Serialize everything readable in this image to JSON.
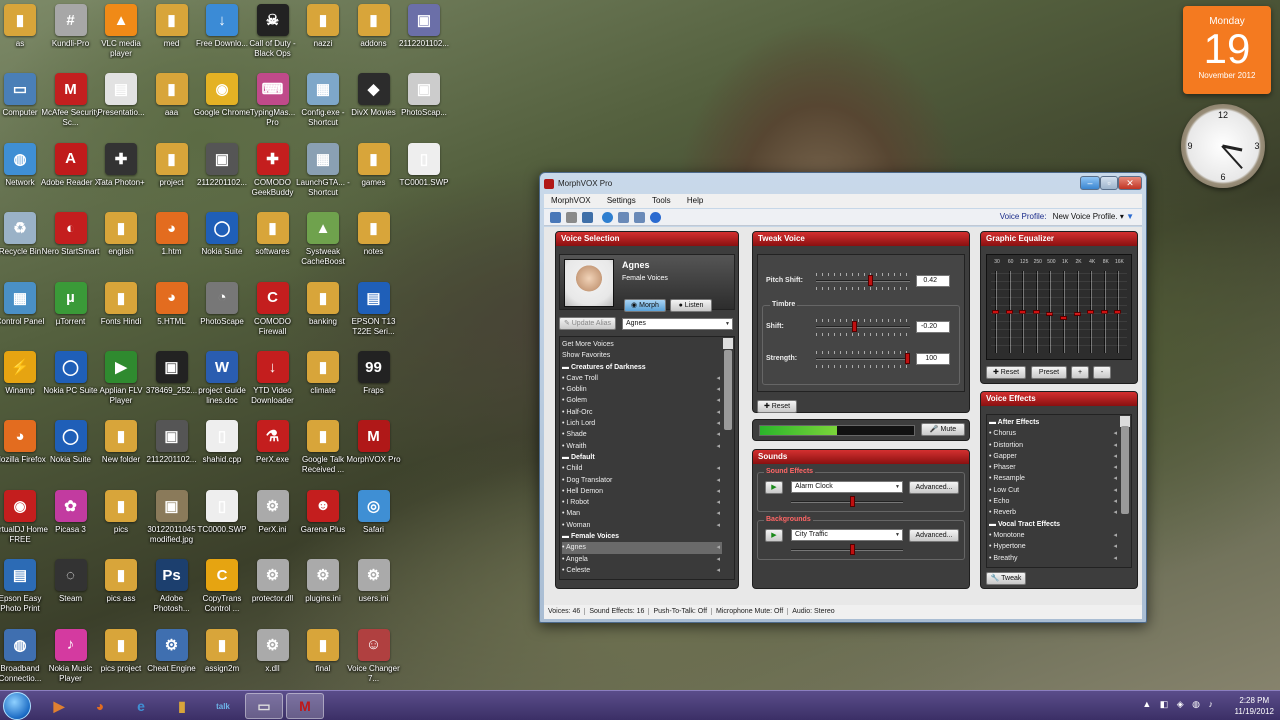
{
  "desktop_icons": [
    {
      "label": "as",
      "color": "#d8a53a",
      "glyph": "▮"
    },
    {
      "label": "Kundli-Pro",
      "color": "#a7a7a7",
      "glyph": "#"
    },
    {
      "label": "VLC media player",
      "color": "#f08a17",
      "glyph": "▲"
    },
    {
      "label": "med",
      "color": "#d8a53a",
      "glyph": "▮"
    },
    {
      "label": "Free Downlo...",
      "color": "#3b8bd6",
      "glyph": "↓"
    },
    {
      "label": "Call of Duty - Black Ops",
      "color": "#222",
      "glyph": "☠"
    },
    {
      "label": "nazzi",
      "color": "#d8a53a",
      "glyph": "▮"
    },
    {
      "label": "addons",
      "color": "#d8a53a",
      "glyph": "▮"
    },
    {
      "label": "2112201102...",
      "color": "#6b6fa8",
      "glyph": "▣"
    },
    {
      "label": "Computer",
      "color": "#4a7fb7",
      "glyph": "▭"
    },
    {
      "label": "McAfee Security Sc...",
      "color": "#c31f1f",
      "glyph": "M"
    },
    {
      "label": "Presentatio...",
      "color": "#e2e2e2",
      "glyph": "▤"
    },
    {
      "label": "aaa",
      "color": "#d8a53a",
      "glyph": "▮"
    },
    {
      "label": "Google Chrome",
      "color": "#e4b224",
      "glyph": "◉"
    },
    {
      "label": "TypingMas... Pro",
      "color": "#c04a8a",
      "glyph": "⌨"
    },
    {
      "label": "Config.exe - Shortcut",
      "color": "#7ea7c9",
      "glyph": "▦"
    },
    {
      "label": "DivX Movies",
      "color": "#2c2c2c",
      "glyph": "◆"
    },
    {
      "label": "PhotoScap...",
      "color": "#cccccc",
      "glyph": "▣"
    },
    {
      "label": "Network",
      "color": "#3f8fd4",
      "glyph": "◍"
    },
    {
      "label": "Adobe Reader X",
      "color": "#c01b1b",
      "glyph": "A"
    },
    {
      "label": "Tata Photon+",
      "color": "#333",
      "glyph": "✚"
    },
    {
      "label": "project",
      "color": "#d8a53a",
      "glyph": "▮"
    },
    {
      "label": "2112201102...",
      "color": "#555",
      "glyph": "▣"
    },
    {
      "label": "COMODO GeekBuddy",
      "color": "#c41e1e",
      "glyph": "✚"
    },
    {
      "label": "LaunchGTA... - Shortcut",
      "color": "#8aa0b3",
      "glyph": "▦"
    },
    {
      "label": "games",
      "color": "#d8a53a",
      "glyph": "▮"
    },
    {
      "label": "TC0001.SWP",
      "color": "#eeeeee",
      "glyph": "▯"
    },
    {
      "label": "Recycle Bin",
      "color": "#9ab2c7",
      "glyph": "♻"
    },
    {
      "label": "Nero StartSmart",
      "color": "#c41e1e",
      "glyph": "◐"
    },
    {
      "label": "english",
      "color": "#d8a53a",
      "glyph": "▮"
    },
    {
      "label": "1.htm",
      "color": "#e36c1f",
      "glyph": "◕"
    },
    {
      "label": "Nokia Suite",
      "color": "#1f5fb8",
      "glyph": "◯"
    },
    {
      "label": "softwares",
      "color": "#d8a53a",
      "glyph": "▮"
    },
    {
      "label": "Systweak CacheBoost",
      "color": "#6fa24d",
      "glyph": "▲"
    },
    {
      "label": "notes",
      "color": "#d8a53a",
      "glyph": "▮"
    },
    {
      "label": "Control Panel",
      "color": "#4a90c6",
      "glyph": "▦"
    },
    {
      "label": "µTorrent",
      "color": "#3a9a38",
      "glyph": "µ"
    },
    {
      "label": "Fonts Hindi",
      "color": "#d8a53a",
      "glyph": "▮"
    },
    {
      "label": "5.HTML",
      "color": "#e36c1f",
      "glyph": "◕"
    },
    {
      "label": "PhotoScape",
      "color": "#777",
      "glyph": "◔"
    },
    {
      "label": "COMODO Firewall",
      "color": "#c41e1e",
      "glyph": "C"
    },
    {
      "label": "banking",
      "color": "#d8a53a",
      "glyph": "▮"
    },
    {
      "label": "EPSON T13 T22E Seri...",
      "color": "#1f5fb8",
      "glyph": "▤"
    },
    {
      "label": "Winamp",
      "color": "#e6a411",
      "glyph": "⚡"
    },
    {
      "label": "Nokia PC Suite",
      "color": "#1f5fb8",
      "glyph": "◯"
    },
    {
      "label": "Applian FLV Player",
      "color": "#2f8a2f",
      "glyph": "▶"
    },
    {
      "label": "378469_252...",
      "color": "#222",
      "glyph": "▣"
    },
    {
      "label": "project Guide lines.doc",
      "color": "#2a5db0",
      "glyph": "W"
    },
    {
      "label": "YTD Video Downloader",
      "color": "#c41e1e",
      "glyph": "↓"
    },
    {
      "label": "climate",
      "color": "#d8a53a",
      "glyph": "▮"
    },
    {
      "label": "Fraps",
      "color": "#222",
      "glyph": "99"
    },
    {
      "label": "Mozilla Firefox",
      "color": "#e36c1f",
      "glyph": "◕"
    },
    {
      "label": "Nokia Suite",
      "color": "#1f5fb8",
      "glyph": "◯"
    },
    {
      "label": "New folder",
      "color": "#d8a53a",
      "glyph": "▮"
    },
    {
      "label": "2112201102...",
      "color": "#555",
      "glyph": "▣"
    },
    {
      "label": "shahid.cpp",
      "color": "#eeeeee",
      "glyph": "▯"
    },
    {
      "label": "PerX.exe",
      "color": "#c41e1e",
      "glyph": "⚗"
    },
    {
      "label": "Google Talk Received ...",
      "color": "#d8a53a",
      "glyph": "▮"
    },
    {
      "label": "MorphVOX Pro",
      "color": "#b01818",
      "glyph": "M"
    },
    {
      "label": "VirtualDJ Home FREE",
      "color": "#c41e1e",
      "glyph": "◉"
    },
    {
      "label": "Picasa 3",
      "color": "#c23ba0",
      "glyph": "✿"
    },
    {
      "label": "pics",
      "color": "#d8a53a",
      "glyph": "▮"
    },
    {
      "label": "30122011045 modified.jpg",
      "color": "#8a7a5a",
      "glyph": "▣"
    },
    {
      "label": "TC0000.SWP",
      "color": "#eeeeee",
      "glyph": "▯"
    },
    {
      "label": "PerX.ini",
      "color": "#aaaaaa",
      "glyph": "⚙"
    },
    {
      "label": "Garena Plus",
      "color": "#c41e1e",
      "glyph": "☻"
    },
    {
      "label": "Safari",
      "color": "#3f8fd4",
      "glyph": "◎"
    },
    {
      "label": "Epson Easy Photo Print",
      "color": "#2c6bb5",
      "glyph": "▤"
    },
    {
      "label": "Steam",
      "color": "#333",
      "glyph": "◌"
    },
    {
      "label": "pics ass",
      "color": "#d8a53a",
      "glyph": "▮"
    },
    {
      "label": "Adobe Photosh...",
      "color": "#1c3f6e",
      "glyph": "Ps"
    },
    {
      "label": "CopyTrans Control ...",
      "color": "#e6a411",
      "glyph": "C"
    },
    {
      "label": "protector.dll",
      "color": "#aaaaaa",
      "glyph": "⚙"
    },
    {
      "label": "plugins.ini",
      "color": "#aaaaaa",
      "glyph": "⚙"
    },
    {
      "label": "users.ini",
      "color": "#aaaaaa",
      "glyph": "⚙"
    },
    {
      "label": "Broadband Connectio...",
      "color": "#3f6fb0",
      "glyph": "◍"
    },
    {
      "label": "Nokia Music Player",
      "color": "#d43aa0",
      "glyph": "♪"
    },
    {
      "label": "pics project",
      "color": "#d8a53a",
      "glyph": "▮"
    },
    {
      "label": "Cheat Engine",
      "color": "#3f6fb0",
      "glyph": "⚙"
    },
    {
      "label": "assign2m",
      "color": "#d8a53a",
      "glyph": "▮"
    },
    {
      "label": "x.dll",
      "color": "#aaaaaa",
      "glyph": "⚙"
    },
    {
      "label": "final",
      "color": "#d8a53a",
      "glyph": "▮"
    },
    {
      "label": "Voice Changer 7...",
      "color": "#b04040",
      "glyph": "☺"
    }
  ],
  "calendar": {
    "weekday": "Monday",
    "day": "19",
    "month_year": "November 2012"
  },
  "clock": {
    "hour": 3,
    "minute": 23
  },
  "taskbar": {
    "time": "2:28 PM",
    "date": "11/19/2012",
    "pinned": [
      {
        "name": "start-button",
        "glyph": ""
      },
      {
        "name": "media-player",
        "glyph": "▶",
        "color": "#e08030"
      },
      {
        "name": "firefox",
        "glyph": "◕",
        "color": "#e36c1f"
      },
      {
        "name": "internet-explorer",
        "glyph": "e",
        "color": "#3f8fd4"
      },
      {
        "name": "explorer",
        "glyph": "▮",
        "color": "#d8a53a"
      },
      {
        "name": "google-talk",
        "glyph": "talk",
        "color": "#6db3e8"
      },
      {
        "name": "window-switcher",
        "glyph": "▭",
        "color": "#ddd"
      },
      {
        "name": "morphvox",
        "glyph": "M",
        "color": "#c01818"
      }
    ]
  },
  "app": {
    "title": "MorphVOX Pro",
    "menu": [
      "MorphVOX",
      "Settings",
      "Tools",
      "Help"
    ],
    "voice_profile_label": "Voice Profile:",
    "voice_profile_value": "New Voice Profile.",
    "voice_selection": {
      "header": "Voice Selection",
      "voice_name": "Agnes",
      "voice_category": "Female Voices",
      "morph_label": "Morph",
      "listen_label": "Listen",
      "update_alias_label": "Update Alias",
      "alias_value": "Agnes",
      "list": [
        {
          "text": "Get More Voices",
          "type": "action"
        },
        {
          "text": "Show Favorites",
          "type": "action"
        },
        {
          "text": "Creatures of Darkness",
          "type": "group"
        },
        {
          "text": "Cave Troll",
          "type": "item"
        },
        {
          "text": "Goblin",
          "type": "item"
        },
        {
          "text": "Golem",
          "type": "item"
        },
        {
          "text": "Half-Orc",
          "type": "item"
        },
        {
          "text": "Lich Lord",
          "type": "item"
        },
        {
          "text": "Shade",
          "type": "item"
        },
        {
          "text": "Wraith",
          "type": "item"
        },
        {
          "text": "Default",
          "type": "group"
        },
        {
          "text": "Child",
          "type": "item"
        },
        {
          "text": "Dog Translator",
          "type": "item"
        },
        {
          "text": "Hell Demon",
          "type": "item"
        },
        {
          "text": "I Robot",
          "type": "item"
        },
        {
          "text": "Man",
          "type": "item"
        },
        {
          "text": "Woman",
          "type": "item"
        },
        {
          "text": "Female Voices",
          "type": "group"
        },
        {
          "text": "Agnes",
          "type": "selected"
        },
        {
          "text": "Angela",
          "type": "item"
        },
        {
          "text": "Celeste",
          "type": "item"
        }
      ]
    },
    "tweak": {
      "header": "Tweak Voice",
      "pitch_label": "Pitch Shift:",
      "pitch_value": "0.42",
      "pitch_level": 0.58,
      "timbre_label": "Timbre",
      "shift_label": "Shift:",
      "shift_value": "-0.20",
      "shift_level": 0.4,
      "strength_label": "Strength:",
      "strength_value": "100",
      "strength_level": 1.0,
      "reset_label": "Reset"
    },
    "meter": {
      "level": 0.5,
      "mute_label": "Mute"
    },
    "sounds": {
      "header": "Sounds",
      "effects_caption": "Sound Effects",
      "effects_value": "Alarm Clock",
      "effects_level": 0.55,
      "backgrounds_caption": "Backgrounds",
      "backgrounds_value": "City Traffic",
      "backgrounds_level": 0.55,
      "advanced_label": "Advanced..."
    },
    "equalizer": {
      "header": "Graphic Equalizer",
      "bands": [
        "30",
        "60",
        "125",
        "250",
        "500",
        "1K",
        "2K",
        "4K",
        "8K",
        "16K"
      ],
      "levels": [
        0.5,
        0.5,
        0.5,
        0.5,
        0.47,
        0.42,
        0.47,
        0.5,
        0.5,
        0.5
      ],
      "reset_label": "Reset",
      "preset_label": "Preset",
      "add_label": "+",
      "remove_label": "-"
    },
    "effects": {
      "header": "Voice Effects",
      "list": [
        {
          "text": "After Effects",
          "type": "group"
        },
        {
          "text": "Chorus",
          "type": "item"
        },
        {
          "text": "Distortion",
          "type": "item"
        },
        {
          "text": "Gapper",
          "type": "item"
        },
        {
          "text": "Phaser",
          "type": "item"
        },
        {
          "text": "Resample",
          "type": "item"
        },
        {
          "text": "Low Cut",
          "type": "item"
        },
        {
          "text": "Echo",
          "type": "item"
        },
        {
          "text": "Reverb",
          "type": "item"
        },
        {
          "text": "Vocal Tract Effects",
          "type": "group"
        },
        {
          "text": "Monotone",
          "type": "item"
        },
        {
          "text": "Hypertone",
          "type": "item"
        },
        {
          "text": "Breathy",
          "type": "item"
        }
      ],
      "tweak_label": "Tweak"
    },
    "status": [
      "Voices: 46",
      "Sound Effects: 16",
      "Push-To-Talk: Off",
      "Microphone Mute: Off",
      "Audio: Stereo"
    ]
  }
}
